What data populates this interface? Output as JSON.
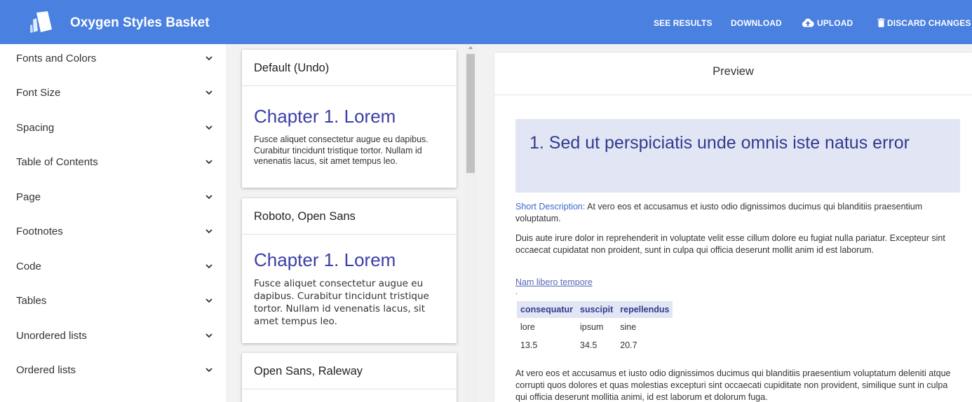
{
  "header": {
    "title": "Oxygen Styles Basket",
    "logo_icon": "oxygen-logo-icon",
    "brand_color": "#4a80e0",
    "nav": [
      {
        "label": "SEE RESULTS",
        "icon": ""
      },
      {
        "label": "DOWNLOAD",
        "icon": ""
      },
      {
        "label": "UPLOAD",
        "icon": "cloud-upload-icon"
      },
      {
        "label": "DISCARD CHANGES",
        "icon": "trash-icon"
      }
    ]
  },
  "sidebar": {
    "items": [
      {
        "label": "Fonts and Colors"
      },
      {
        "label": "Font Size"
      },
      {
        "label": "Spacing"
      },
      {
        "label": "Table of Contents"
      },
      {
        "label": "Page"
      },
      {
        "label": "Footnotes"
      },
      {
        "label": "Code"
      },
      {
        "label": "Tables"
      },
      {
        "label": "Unordered lists"
      },
      {
        "label": "Ordered lists"
      }
    ]
  },
  "styles": {
    "cards": [
      {
        "title": "Default (Undo)",
        "heading": "Chapter 1. Lorem",
        "body": "Fusce aliquet consectetur augue eu dapibus. Curabitur tincidunt tristique tortor. Nullam id venenatis lacus, sit amet tempus leo."
      },
      {
        "title": "Roboto, Open Sans",
        "heading": "Chapter 1. Lorem",
        "body": "Fusce aliquet consectetur augue eu dapibus. Curabitur tincidunt tristique tortor. Nullam id venenatis lacus, sit amet tempus leo."
      },
      {
        "title": "Open Sans, Raleway",
        "heading": "",
        "body": ""
      }
    ]
  },
  "preview": {
    "title": "Preview",
    "heading": "1. Sed ut perspiciatis unde omnis iste natus error",
    "short_label": "Short Description:",
    "short_text": " At vero eos et accusamus et iusto odio dignissimos ducimus qui blanditiis praesentium voluptatum.",
    "paragraph1": "Duis aute irure dolor in reprehenderit in voluptate velit esse cillum dolore eu fugiat nulla pariatur. Excepteur sint occaecat cupidatat non proident, sunt in culpa qui officia deserunt mollit anim id est laborum.",
    "link": "Nam libero tempore",
    "dot": ".",
    "table": {
      "headers": [
        "consequatur",
        "suscipit",
        "repellendus"
      ],
      "rows": [
        [
          "lore",
          "ipsum",
          "sine"
        ],
        [
          "13.5",
          "34.5",
          "20.7"
        ]
      ]
    },
    "paragraph2": "At vero eos et accusamus et iusto odio dignissimos ducimus qui blanditiis praesentium voluptatum deleniti atque corrupti quos dolores et quas molestias excepturi sint occaecati cupiditate non provident, similique sunt in culpa qui officia deserunt mollitia animi, id est laborum et dolorum fuga."
  }
}
